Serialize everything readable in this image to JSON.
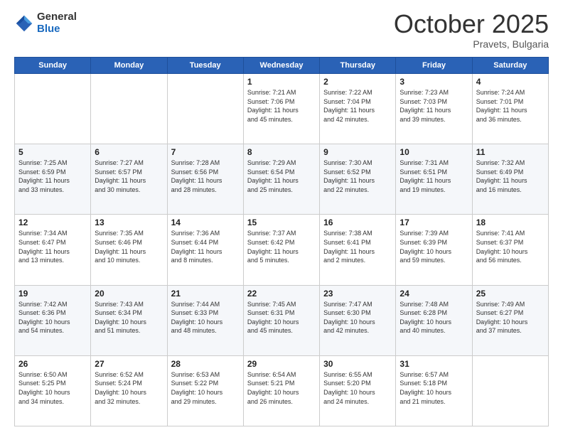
{
  "header": {
    "logo_general": "General",
    "logo_blue": "Blue",
    "month": "October 2025",
    "location": "Pravets, Bulgaria"
  },
  "weekdays": [
    "Sunday",
    "Monday",
    "Tuesday",
    "Wednesday",
    "Thursday",
    "Friday",
    "Saturday"
  ],
  "weeks": [
    [
      {
        "day": "",
        "info": ""
      },
      {
        "day": "",
        "info": ""
      },
      {
        "day": "",
        "info": ""
      },
      {
        "day": "1",
        "info": "Sunrise: 7:21 AM\nSunset: 7:06 PM\nDaylight: 11 hours\nand 45 minutes."
      },
      {
        "day": "2",
        "info": "Sunrise: 7:22 AM\nSunset: 7:04 PM\nDaylight: 11 hours\nand 42 minutes."
      },
      {
        "day": "3",
        "info": "Sunrise: 7:23 AM\nSunset: 7:03 PM\nDaylight: 11 hours\nand 39 minutes."
      },
      {
        "day": "4",
        "info": "Sunrise: 7:24 AM\nSunset: 7:01 PM\nDaylight: 11 hours\nand 36 minutes."
      }
    ],
    [
      {
        "day": "5",
        "info": "Sunrise: 7:25 AM\nSunset: 6:59 PM\nDaylight: 11 hours\nand 33 minutes."
      },
      {
        "day": "6",
        "info": "Sunrise: 7:27 AM\nSunset: 6:57 PM\nDaylight: 11 hours\nand 30 minutes."
      },
      {
        "day": "7",
        "info": "Sunrise: 7:28 AM\nSunset: 6:56 PM\nDaylight: 11 hours\nand 28 minutes."
      },
      {
        "day": "8",
        "info": "Sunrise: 7:29 AM\nSunset: 6:54 PM\nDaylight: 11 hours\nand 25 minutes."
      },
      {
        "day": "9",
        "info": "Sunrise: 7:30 AM\nSunset: 6:52 PM\nDaylight: 11 hours\nand 22 minutes."
      },
      {
        "day": "10",
        "info": "Sunrise: 7:31 AM\nSunset: 6:51 PM\nDaylight: 11 hours\nand 19 minutes."
      },
      {
        "day": "11",
        "info": "Sunrise: 7:32 AM\nSunset: 6:49 PM\nDaylight: 11 hours\nand 16 minutes."
      }
    ],
    [
      {
        "day": "12",
        "info": "Sunrise: 7:34 AM\nSunset: 6:47 PM\nDaylight: 11 hours\nand 13 minutes."
      },
      {
        "day": "13",
        "info": "Sunrise: 7:35 AM\nSunset: 6:46 PM\nDaylight: 11 hours\nand 10 minutes."
      },
      {
        "day": "14",
        "info": "Sunrise: 7:36 AM\nSunset: 6:44 PM\nDaylight: 11 hours\nand 8 minutes."
      },
      {
        "day": "15",
        "info": "Sunrise: 7:37 AM\nSunset: 6:42 PM\nDaylight: 11 hours\nand 5 minutes."
      },
      {
        "day": "16",
        "info": "Sunrise: 7:38 AM\nSunset: 6:41 PM\nDaylight: 11 hours\nand 2 minutes."
      },
      {
        "day": "17",
        "info": "Sunrise: 7:39 AM\nSunset: 6:39 PM\nDaylight: 10 hours\nand 59 minutes."
      },
      {
        "day": "18",
        "info": "Sunrise: 7:41 AM\nSunset: 6:37 PM\nDaylight: 10 hours\nand 56 minutes."
      }
    ],
    [
      {
        "day": "19",
        "info": "Sunrise: 7:42 AM\nSunset: 6:36 PM\nDaylight: 10 hours\nand 54 minutes."
      },
      {
        "day": "20",
        "info": "Sunrise: 7:43 AM\nSunset: 6:34 PM\nDaylight: 10 hours\nand 51 minutes."
      },
      {
        "day": "21",
        "info": "Sunrise: 7:44 AM\nSunset: 6:33 PM\nDaylight: 10 hours\nand 48 minutes."
      },
      {
        "day": "22",
        "info": "Sunrise: 7:45 AM\nSunset: 6:31 PM\nDaylight: 10 hours\nand 45 minutes."
      },
      {
        "day": "23",
        "info": "Sunrise: 7:47 AM\nSunset: 6:30 PM\nDaylight: 10 hours\nand 42 minutes."
      },
      {
        "day": "24",
        "info": "Sunrise: 7:48 AM\nSunset: 6:28 PM\nDaylight: 10 hours\nand 40 minutes."
      },
      {
        "day": "25",
        "info": "Sunrise: 7:49 AM\nSunset: 6:27 PM\nDaylight: 10 hours\nand 37 minutes."
      }
    ],
    [
      {
        "day": "26",
        "info": "Sunrise: 6:50 AM\nSunset: 5:25 PM\nDaylight: 10 hours\nand 34 minutes."
      },
      {
        "day": "27",
        "info": "Sunrise: 6:52 AM\nSunset: 5:24 PM\nDaylight: 10 hours\nand 32 minutes."
      },
      {
        "day": "28",
        "info": "Sunrise: 6:53 AM\nSunset: 5:22 PM\nDaylight: 10 hours\nand 29 minutes."
      },
      {
        "day": "29",
        "info": "Sunrise: 6:54 AM\nSunset: 5:21 PM\nDaylight: 10 hours\nand 26 minutes."
      },
      {
        "day": "30",
        "info": "Sunrise: 6:55 AM\nSunset: 5:20 PM\nDaylight: 10 hours\nand 24 minutes."
      },
      {
        "day": "31",
        "info": "Sunrise: 6:57 AM\nSunset: 5:18 PM\nDaylight: 10 hours\nand 21 minutes."
      },
      {
        "day": "",
        "info": ""
      }
    ]
  ]
}
